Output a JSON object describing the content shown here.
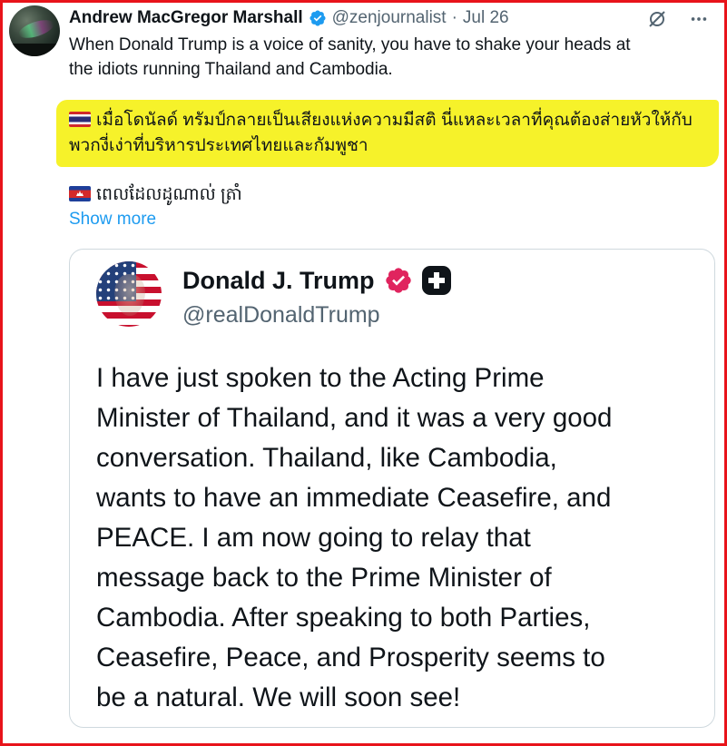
{
  "tweet": {
    "author_name": "Andrew MacGregor Marshall",
    "handle": "@zenjournalist",
    "separator": "·",
    "date": "Jul 26",
    "line1": "When Donald Trump is a voice of sanity, you have to shake your heads at",
    "line2": "the idiots running Thailand and Cambodia.",
    "thai_line1": "เมื่อโดนัลด์ ทรัมป์กลายเป็นเสียงแห่งความมีสติ นี่แหละเวลาที่คุณต้องส่ายหัวให้กับ",
    "thai_line2": "พวกงี่เง่าที่บริหารประเทศไทยและกัมพูชา",
    "khmer_line": "ពេលដែលដូណាល់ ត្រាំ",
    "show_more": "Show more"
  },
  "icons": {
    "verified": "verified-badge-icon",
    "grok": "grok-icon",
    "more": "more-icon",
    "thai_flag": "thailand-flag-icon",
    "cambodia_flag": "cambodia-flag-icon"
  },
  "quoted": {
    "author_name": "Donald J. Trump",
    "handle": "@realDonaldTrump",
    "body_lines": [
      "I have just spoken to the Acting Prime",
      "Minister of Thailand, and it was a very good",
      "conversation. Thailand, like Cambodia,",
      "wants to have an immediate Ceasefire, and",
      "PEACE. I am now going to relay that",
      "message back to the Prime Minister of",
      "Cambodia. After speaking to both Parties,",
      "Ceasefire, Peace, and Prosperity seems to",
      "be a natural. We will soon see!"
    ]
  },
  "colors": {
    "border_highlight": "#e8141a",
    "text_highlight": "#f6f22a",
    "link": "#1d9bf0",
    "verified_blue": "#1d9bf0",
    "verified_pink": "#e0245e"
  }
}
